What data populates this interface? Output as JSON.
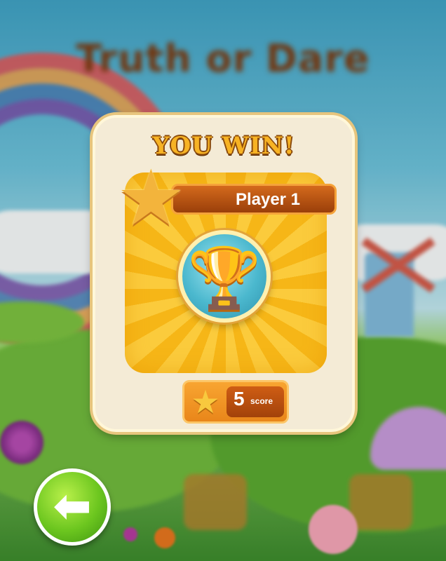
{
  "background": {
    "title": "Truth or Dare"
  },
  "modal": {
    "heading": "YOU WIN!",
    "player_name": "Player 1",
    "score_value": "5",
    "score_label": "score",
    "colors": {
      "panel": "#f4ebd6",
      "banner": "#b34d10",
      "sunburst": "#f6b617",
      "trophy_circle": "#4bb8ce"
    }
  },
  "icons": {
    "player_star": "star-icon",
    "trophy": "trophy-icon",
    "score_star": "star-icon",
    "back": "arrow-left-icon"
  },
  "back_button": {
    "color": "#6cc61f"
  }
}
